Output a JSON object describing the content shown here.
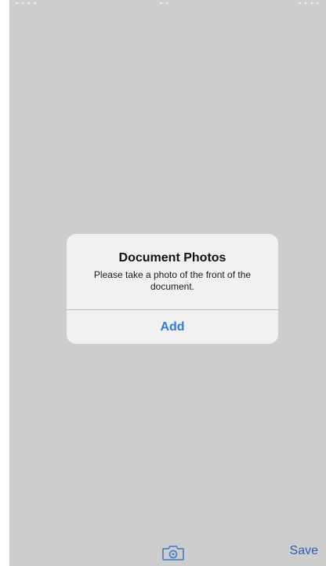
{
  "status_bar": {
    "left": "• • • •",
    "center": "• •",
    "right": "• • • •"
  },
  "dialog": {
    "title": "Document Photos",
    "message": "Please take a photo of the front of the document.",
    "action_label": "Add"
  },
  "toolbar": {
    "camera_icon": "camera-icon",
    "save_label": "Save"
  },
  "colors": {
    "background": "#cdcdcd",
    "dialog_background": "#f1f1f1",
    "accent": "#2f7de1"
  }
}
